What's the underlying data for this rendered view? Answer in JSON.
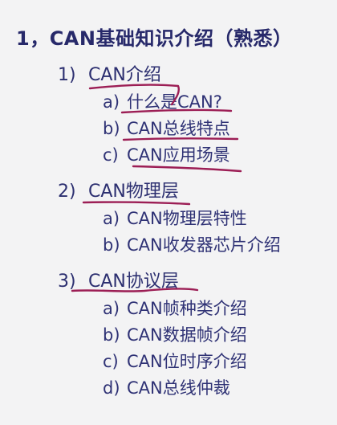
{
  "title": "1，CAN基础知识介绍（熟悉）",
  "sections": [
    {
      "num": "1)",
      "label": "CAN介绍",
      "items": [
        {
          "letter": "a)",
          "text": "什么是CAN?"
        },
        {
          "letter": "b)",
          "text": "CAN总线特点"
        },
        {
          "letter": "c)",
          "text": "CAN应用场景"
        }
      ]
    },
    {
      "num": "2)",
      "label": "CAN物理层",
      "items": [
        {
          "letter": "a)",
          "text": "CAN物理层特性"
        },
        {
          "letter": "b)",
          "text": "CAN收发器芯片介绍"
        }
      ]
    },
    {
      "num": "3)",
      "label": "CAN协议层",
      "items": [
        {
          "letter": "a)",
          "text": "CAN帧种类介绍"
        },
        {
          "letter": "b)",
          "text": "CAN数据帧介绍"
        },
        {
          "letter": "c)",
          "text": "CAN位时序介绍"
        },
        {
          "letter": "d)",
          "text": "CAN总线仲裁"
        }
      ]
    }
  ],
  "colors": {
    "text": "#2b2f6e",
    "annotation_ink": "#9c1e55",
    "background": "#f3f3f4"
  }
}
